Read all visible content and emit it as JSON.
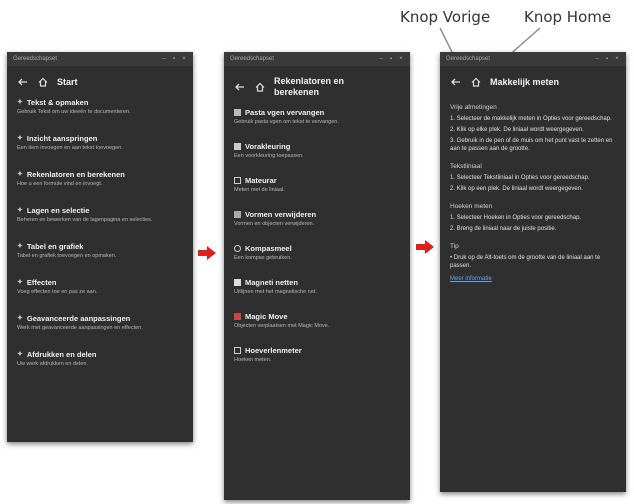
{
  "callouts": {
    "back": "Knop Vorige",
    "home": "Knop Home"
  },
  "colors": {
    "panel_bg": "#2f2f2f",
    "arrow_red": "#e0201c",
    "link_blue": "#6aa6e6",
    "leader_line": "#8a8a8a"
  },
  "panel1": {
    "window_title": "Gereedschapset",
    "nav_title": "Start",
    "items": [
      {
        "title": "Tekst & opmaken",
        "desc": "Gebruik Tekst om uw ideeën te documenteren."
      },
      {
        "title": "Inzicht aanspringen",
        "desc": "Een item invoegen en aan tekst toevoegen."
      },
      {
        "title": "Rekenlatoren en berekenen",
        "desc": "Hoe u een formule vind en invoegt."
      },
      {
        "title": "Lagen en selectie",
        "desc": "Beheren en bewerken van de lagenpagina en selecties."
      },
      {
        "title": "Tabel en grafiek",
        "desc": "Tabel en grafiek toevoegen en opmaken."
      },
      {
        "title": "Effecten",
        "desc": "Voeg effecten toe en pas ze aan."
      },
      {
        "title": "Geavanceerde aanpassingen",
        "desc": "Werk met geavanceerde aanpassingen en effecten."
      },
      {
        "title": "Afdrukken en delen",
        "desc": "Uw werk afdrukken en delen."
      }
    ]
  },
  "panel2": {
    "window_title": "Gereedschapset",
    "nav_title": "Rekenlatoren en berekenen",
    "items": [
      {
        "icon": "pen-icon",
        "title": "Pasta vgen vervangen",
        "desc": "Gebruik pasta vgen om tekst te vervangen."
      },
      {
        "icon": "fill-icon",
        "title": "Vorakleuring",
        "desc": "Een voorkleuring toepassen."
      },
      {
        "icon": "ruler-icon",
        "title": "Mateurar",
        "desc": "Meten met de liniaal."
      },
      {
        "icon": "shape-icon",
        "title": "Vormen verwijderen",
        "desc": "Vormen en objecten verwijderen."
      },
      {
        "icon": "compass-icon",
        "title": "Kompasmeel",
        "desc": "Een kompas gebruiken."
      },
      {
        "icon": "magnet-icon",
        "title": "Magneti netten",
        "desc": "Uitlijnen met het magnetische net."
      },
      {
        "icon": "magic-icon",
        "title": "Magic Move",
        "desc": "Objecten verplaatsen met Magic Move."
      },
      {
        "icon": "protractor-icon",
        "title": "Hoeverlenmeter",
        "desc": "Hoeken meten."
      }
    ]
  },
  "panel3": {
    "window_title": "Gereedschapset",
    "nav_title": "Makkelijk meten",
    "sections": [
      {
        "heading": "Vrije afmetingen",
        "steps": [
          "1. Selecteer de makkelijk meten in Opties voor gereedschap.",
          "2. Klik op elke plek. De liniaal wordt weergegeven.",
          "3. Gebruik in de pen of de muis om het punt vast te zetten en aan te passen aan de grootte."
        ]
      },
      {
        "heading": "Tekstliniaal",
        "steps": [
          "1. Selecteer Tekstliniaal in Opties voor gereedschap.",
          "2. Klik op een plek. De liniaal wordt weergegeven."
        ]
      },
      {
        "heading": "Hoeken meten",
        "steps": [
          "1. Selecteer Hoeken in Opties voor gereedschap.",
          "2. Breng de liniaal naar de juiste positie."
        ]
      },
      {
        "heading": "Tip",
        "steps": [
          "• Druk op de Alt-toets om de grootte van de liniaal aan te passen."
        ]
      }
    ],
    "link": "Meer informatie"
  }
}
